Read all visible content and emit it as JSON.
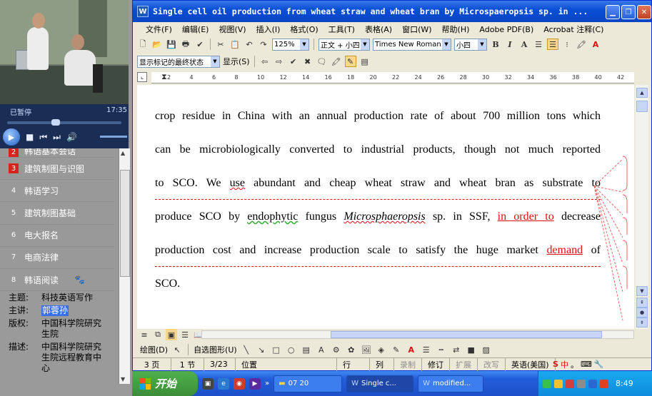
{
  "player": {
    "status": "已暂停",
    "time": "17:35",
    "seek_fraction": 0.41
  },
  "playlist": [
    {
      "num": "2",
      "label": "韩语基本会话",
      "badge": "red"
    },
    {
      "num": "3",
      "label": "建筑制图与识图",
      "badge": "red"
    },
    {
      "num": "4",
      "label": "韩语学习",
      "badge": "grey"
    },
    {
      "num": "5",
      "label": "建筑制图基础",
      "badge": "grey"
    },
    {
      "num": "6",
      "label": "电大报名",
      "badge": "grey"
    },
    {
      "num": "7",
      "label": "电商法律",
      "badge": "grey"
    },
    {
      "num": "8",
      "label": "韩语阅读",
      "badge": "grey"
    }
  ],
  "info": {
    "topic_k": "主题:",
    "topic_v": "科技英语写作",
    "speaker_k": "主讲:",
    "speaker_v": "郭蓉孙",
    "copyright_k": "版权:",
    "copyright_v": "中国科学院研究生院",
    "desc_k": "描述:",
    "desc_v": "中国科学院研究生院远程教育中心"
  },
  "word": {
    "title": "Single cell oil production from wheat straw and wheat bran by Microspaeropsis sp. in ...",
    "menu": [
      "文件(F)",
      "编辑(E)",
      "视图(V)",
      "插入(I)",
      "格式(O)",
      "工具(T)",
      "表格(A)",
      "窗口(W)",
      "帮助(H)",
      "Adobe PDF(B)",
      "Acrobat 注释(C)"
    ],
    "zoom": "125%",
    "style": "正文 + 小四",
    "font": "Times New Roman",
    "size": "小四",
    "markup_mode": "显示标记的最终状态",
    "show_label": "显示(S)",
    "ruler_ticks": [
      "2",
      "4",
      "6",
      "8",
      "10",
      "12",
      "14",
      "16",
      "18",
      "20",
      "22",
      "24",
      "26",
      "28",
      "30",
      "32",
      "34",
      "36",
      "38",
      "40",
      "42"
    ],
    "doc_lines": [
      "crop residue in China with an annual production rate of about 700 million tons which",
      "can be microbiologically converted to industrial products, though not much reported",
      "to SCO. We use abundant and cheap wheat straw and wheat bran as substrate to",
      "produce SCO by endophytic fungus Microsphaeropsis sp. in SSF, in order to decrease",
      "production cost and increase production scale to satisfy the huge market demand of",
      "SCO."
    ],
    "line3_parts": [
      "to SCO. We ",
      "use",
      " abundant and cheap wheat straw and wheat bran as substrate to"
    ],
    "line4_parts": [
      "produce SCO by ",
      "endophytic",
      " fungus ",
      "Microsphaeropsis",
      " sp. in SSF, ",
      "in order to",
      " decrease"
    ],
    "line5_parts": [
      "production cost and increase production scale to satisfy the huge market ",
      "demand",
      " of"
    ],
    "draw_label": "绘图(D)",
    "autoshape_label": "自选图形(U)",
    "status": {
      "page": "3 页",
      "section": "1 节",
      "pos": "3/23",
      "at": "位置",
      "line": "行",
      "col": "列",
      "rec": "录制",
      "trk": "修订",
      "ext": "扩展",
      "ovr": "改写",
      "lang": "英语(美国)"
    }
  },
  "taskbar": {
    "start": "开始",
    "tasks": [
      "07 20",
      "Single c...",
      "modified..."
    ],
    "clock": "8:49"
  },
  "colors": {
    "titlebar": "#0A4FD6",
    "revision_red": "#E01010",
    "taskbar": "#245EDB",
    "start_green": "#3C8E38",
    "playlist_badge_red": "#D8231E"
  }
}
